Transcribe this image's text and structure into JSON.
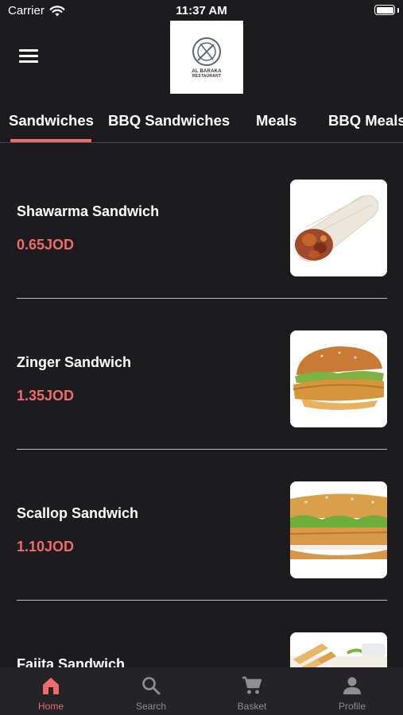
{
  "status_bar": {
    "carrier": "Carrier",
    "time": "11:37 AM"
  },
  "header": {
    "logo_line1": "AL BARAKA",
    "logo_line2": "RESTAURANT"
  },
  "tabs": [
    {
      "label": "Sandwiches",
      "active": true
    },
    {
      "label": "BBQ Sandwiches",
      "active": false
    },
    {
      "label": "Meals",
      "active": false
    },
    {
      "label": "BBQ Meals",
      "active": false
    }
  ],
  "items": [
    {
      "name": "Shawarma Sandwich",
      "price": "0.65JOD",
      "image": "shawarma-image"
    },
    {
      "name": "Zinger Sandwich",
      "price": "1.35JOD",
      "image": "zinger-image"
    },
    {
      "name": "Scallop Sandwich",
      "price": "1.10JOD",
      "image": "scallop-image"
    },
    {
      "name": "Fajita Sandwich",
      "price": "",
      "image": "fajita-image"
    }
  ],
  "bottom_nav": [
    {
      "label": "Home",
      "icon": "home-icon",
      "active": true
    },
    {
      "label": "Search",
      "icon": "search-icon",
      "active": false
    },
    {
      "label": "Basket",
      "icon": "cart-icon",
      "active": false
    },
    {
      "label": "Profile",
      "icon": "profile-icon",
      "active": false
    }
  ],
  "colors": {
    "accent": "#ef6b6b",
    "background": "#1c1c1e",
    "nav_background": "#242426"
  }
}
